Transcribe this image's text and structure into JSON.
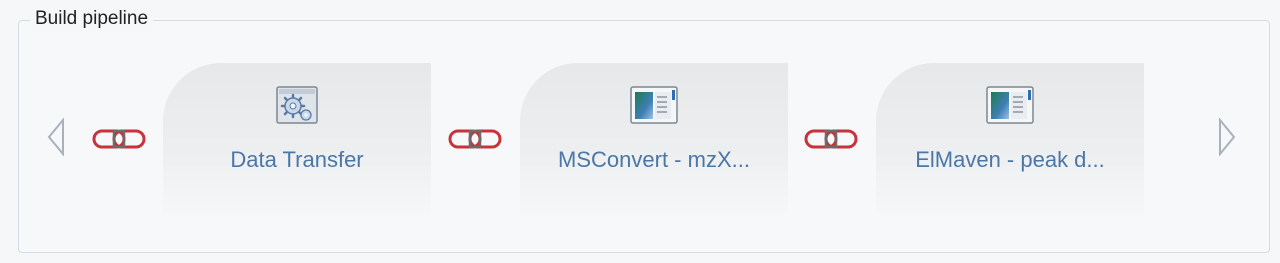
{
  "panel": {
    "title": "Build pipeline"
  },
  "nav": {
    "prev_icon": "chevron-left-icon",
    "next_icon": "chevron-right-icon"
  },
  "connector_icon": "chain-link-icon",
  "colors": {
    "link_red": "#c8323a",
    "label_blue": "#4a77a8",
    "border": "#d3dce4"
  },
  "steps": [
    {
      "label": "Data Transfer",
      "icon": "gear-settings-icon"
    },
    {
      "label": "MSConvert - mzX...",
      "icon": "app-window-icon"
    },
    {
      "label": "ElMaven - peak d...",
      "icon": "app-window-icon"
    }
  ]
}
